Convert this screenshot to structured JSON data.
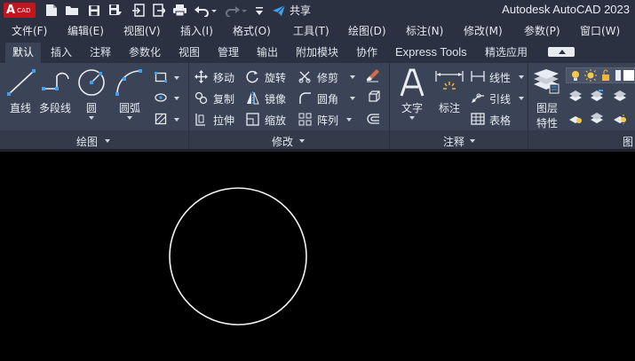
{
  "title_bar": {
    "logo_text": "A",
    "logo_sub": "CAD",
    "share_label": "共享",
    "app_title": "Autodesk AutoCAD 2023",
    "quick_access_icons": [
      "new-file-icon",
      "open-folder-icon",
      "save-icon",
      "save-as-icon",
      "import-icon",
      "export-icon",
      "print-icon",
      "undo-icon",
      "redo-icon",
      "customize-icon"
    ]
  },
  "menu": [
    "文件(F)",
    "编辑(E)",
    "视图(V)",
    "插入(I)",
    "格式(O)",
    "工具(T)",
    "绘图(D)",
    "标注(N)",
    "修改(M)",
    "参数(P)",
    "窗口(W)"
  ],
  "tabs": [
    "默认",
    "插入",
    "注释",
    "参数化",
    "视图",
    "管理",
    "输出",
    "附加模块",
    "协作",
    "Express Tools",
    "精选应用"
  ],
  "active_tab": "默认",
  "ribbon": {
    "draw": {
      "title": "绘图",
      "line": "直线",
      "polyline": "多段线",
      "circle": "圆",
      "arc": "圆弧"
    },
    "modify": {
      "title": "修改",
      "move": "移动",
      "rotate": "旋转",
      "trim": "修剪",
      "copy": "复制",
      "mirror": "镜像",
      "fillet": "圆角",
      "stretch": "拉伸",
      "scale": "缩放",
      "array": "阵列"
    },
    "annotation": {
      "title": "注释",
      "text": "文字",
      "dimension": "标注",
      "linear": "线性",
      "leader": "引线",
      "table": "表格"
    },
    "layers": {
      "properties_line1": "图层",
      "properties_line2": "特性",
      "title": "图"
    }
  },
  "accent_colors": {
    "logo_red": "#c4141d",
    "share_blue": "#3ea1f0",
    "ribbon_bg": "#3b4456",
    "bar_bg": "#2b3140"
  }
}
